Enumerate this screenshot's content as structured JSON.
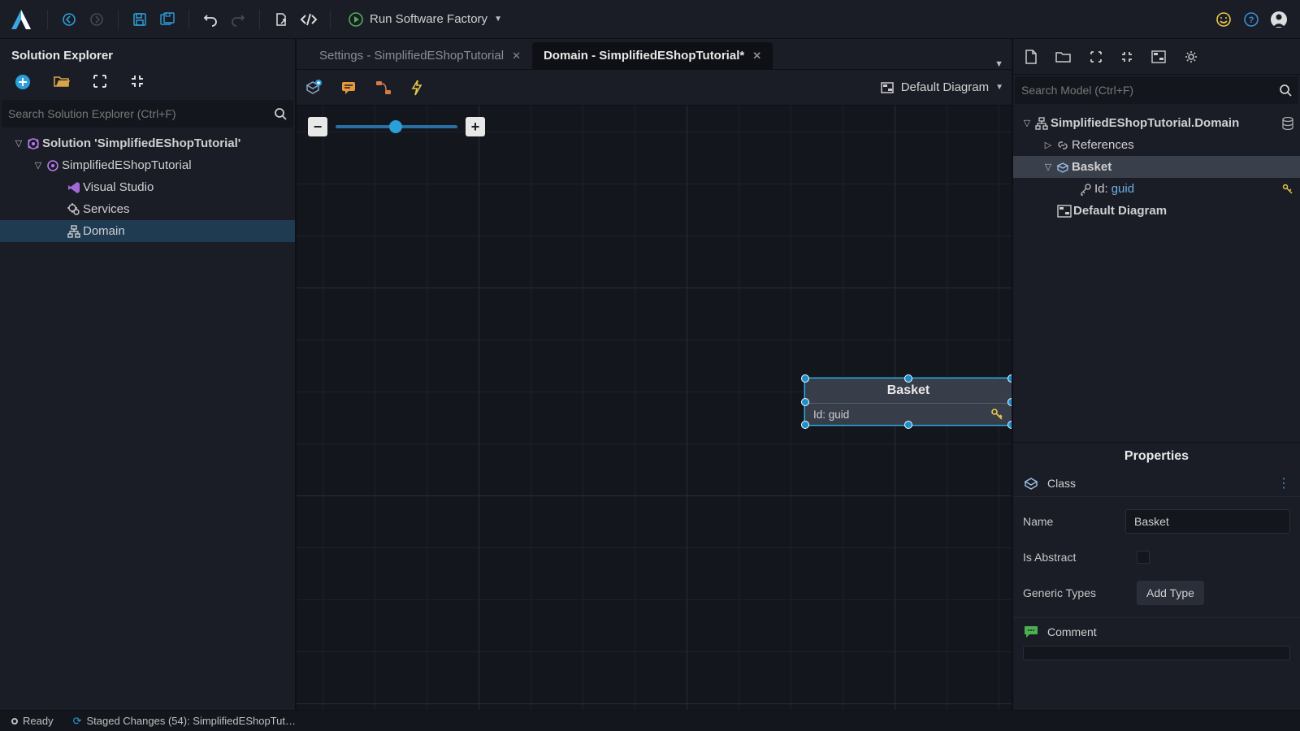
{
  "toolbar": {
    "run_label": "Run Software Factory"
  },
  "sidebar_left": {
    "title": "Solution Explorer",
    "search_placeholder": "Search Solution Explorer (Ctrl+F)",
    "tree": {
      "solution_label": "Solution 'SimplifiedEShopTutorial'",
      "project_label": "SimplifiedEShopTutorial",
      "items": [
        {
          "label": "Visual Studio"
        },
        {
          "label": "Services"
        },
        {
          "label": "Domain"
        }
      ]
    }
  },
  "tabs": [
    {
      "label": "Settings - SimplifiedEShopTutorial",
      "active": false
    },
    {
      "label": "Domain - SimplifiedEShopTutorial*",
      "active": true
    }
  ],
  "canvas_toolbar": {
    "diagram_label": "Default Diagram"
  },
  "entity": {
    "name": "Basket",
    "attribute": "Id: guid"
  },
  "sidebar_right": {
    "search_placeholder": "Search Model (Ctrl+F)",
    "root_label": "SimplifiedEShopTutorial.Domain",
    "references_label": "References",
    "basket_label": "Basket",
    "id_label": "Id:",
    "id_type": "guid",
    "default_diagram_label": "Default Diagram"
  },
  "properties": {
    "title": "Properties",
    "class_label": "Class",
    "name_label": "Name",
    "name_value": "Basket",
    "abstract_label": "Is Abstract",
    "generic_label": "Generic Types",
    "add_type_label": "Add Type",
    "comment_label": "Comment"
  },
  "statusbar": {
    "ready": "Ready",
    "staged": "Staged Changes (54): SimplifiedEShopTut…"
  }
}
